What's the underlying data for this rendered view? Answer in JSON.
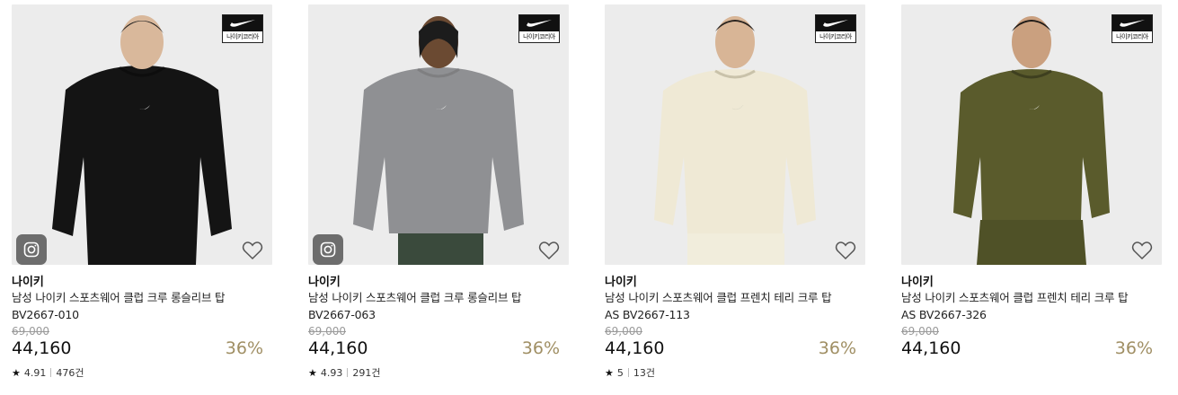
{
  "colors": {
    "accent_discount": "#a08f64",
    "original_price": "#9a9a9a",
    "thumb_bg": "#ececec"
  },
  "badge": {
    "text": "나이키코리아",
    "logo_icon": "nike-swoosh-icon"
  },
  "products": [
    {
      "brand": "나이키",
      "name": "남성 나이키 스포츠웨어 클럽 크루 롱슬리브 탑 BV2667-010",
      "original_price": "69,000",
      "sale_price": "44,160",
      "discount": "36%",
      "rating": "4.91",
      "reviews": "476건",
      "garment_color": "#141414",
      "has_instagram": true,
      "wishlist_icon": "heart-outline-icon"
    },
    {
      "brand": "나이키",
      "name": "남성 나이키 스포츠웨어 클럽 크루 롱슬리브 탑 BV2667-063",
      "original_price": "69,000",
      "sale_price": "44,160",
      "discount": "36%",
      "rating": "4.93",
      "reviews": "291건",
      "garment_color": "#8f9093",
      "has_instagram": true,
      "wishlist_icon": "heart-outline-icon"
    },
    {
      "brand": "나이키",
      "name": "남성 나이키 스포츠웨어 클럽 프렌치 테리 크루 탑 AS BV2667-113",
      "original_price": "69,000",
      "sale_price": "44,160",
      "discount": "36%",
      "rating": "5",
      "reviews": "13건",
      "garment_color": "#efe9d5",
      "has_instagram": false,
      "wishlist_icon": "heart-outline-icon"
    },
    {
      "brand": "나이키",
      "name": "남성 나이키 스포츠웨어 클럽 프렌치 테리 크루 탑 AS BV2667-326",
      "original_price": "69,000",
      "sale_price": "44,160",
      "discount": "36%",
      "rating": "",
      "reviews": "",
      "garment_color": "#5a5b2c",
      "has_instagram": false,
      "wishlist_icon": "heart-outline-icon"
    }
  ]
}
